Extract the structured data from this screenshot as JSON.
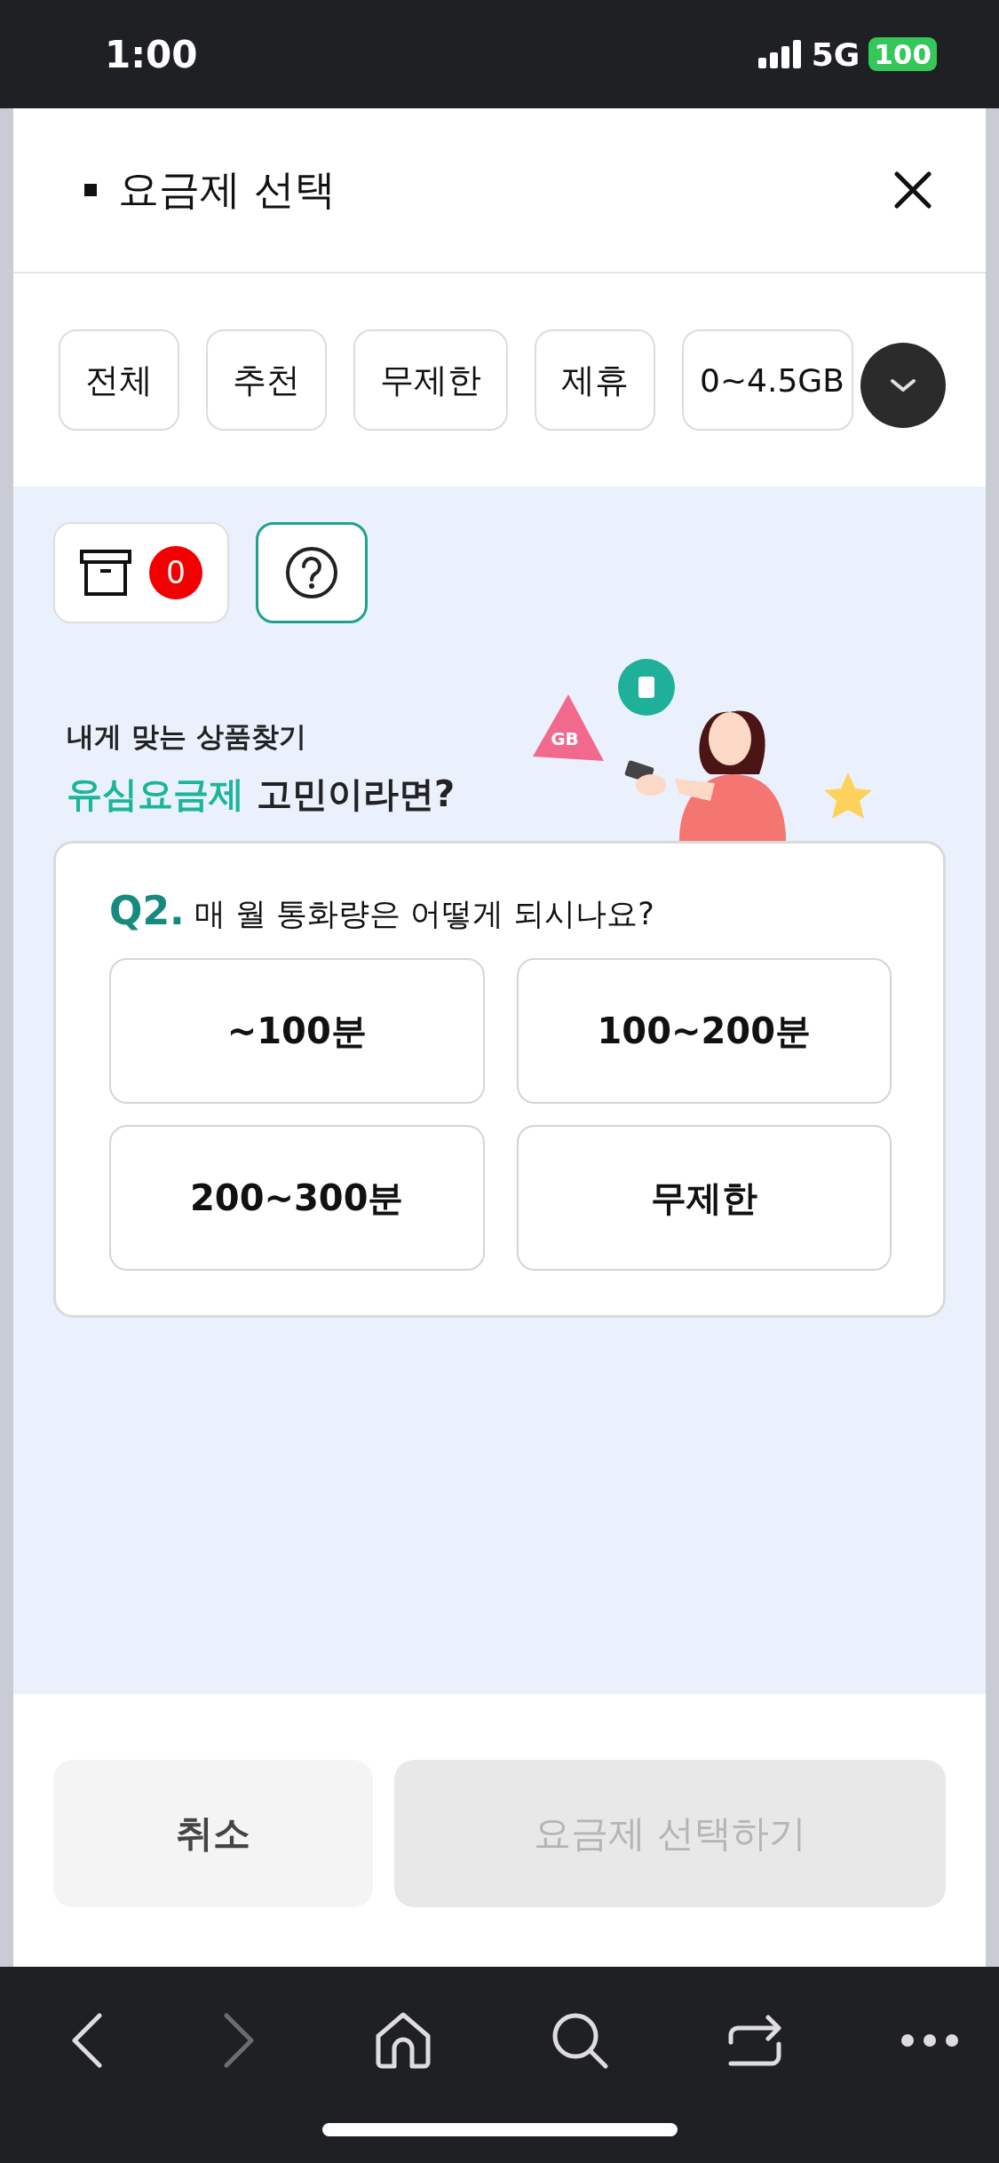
{
  "status_bar": {
    "time": "1:00",
    "network": "5G",
    "battery": "100"
  },
  "header": {
    "title": "요금제 선택"
  },
  "filter_chips": [
    {
      "label": "전체"
    },
    {
      "label": "추천"
    },
    {
      "label": "무제한"
    },
    {
      "label": "제휴"
    },
    {
      "label": "0~4.5GB"
    }
  ],
  "tools": {
    "compare_count": "0"
  },
  "promo": {
    "subtitle": "내게 맞는 상품찾기",
    "headline_highlight": "유심요금제",
    "headline_rest": "고민이라면?",
    "illustration_tag": "GB"
  },
  "question": {
    "number": "Q2.",
    "text": "매 월 통화량은 어떻게 되시나요?",
    "options": [
      {
        "label": "~100분"
      },
      {
        "label": "100~200분"
      },
      {
        "label": "200~300분"
      },
      {
        "label": "무제한"
      }
    ]
  },
  "footer": {
    "cancel": {
      "label": "취소",
      "disabled": false
    },
    "confirm": {
      "label": "요금제 선택하기",
      "disabled": true
    }
  },
  "browser_bar": [
    {
      "kind": "back",
      "disabled": false
    },
    {
      "kind": "forward",
      "disabled": true
    },
    {
      "kind": "home",
      "disabled": false
    },
    {
      "kind": "search",
      "disabled": false
    },
    {
      "kind": "share",
      "disabled": false
    },
    {
      "kind": "more",
      "disabled": false
    }
  ]
}
